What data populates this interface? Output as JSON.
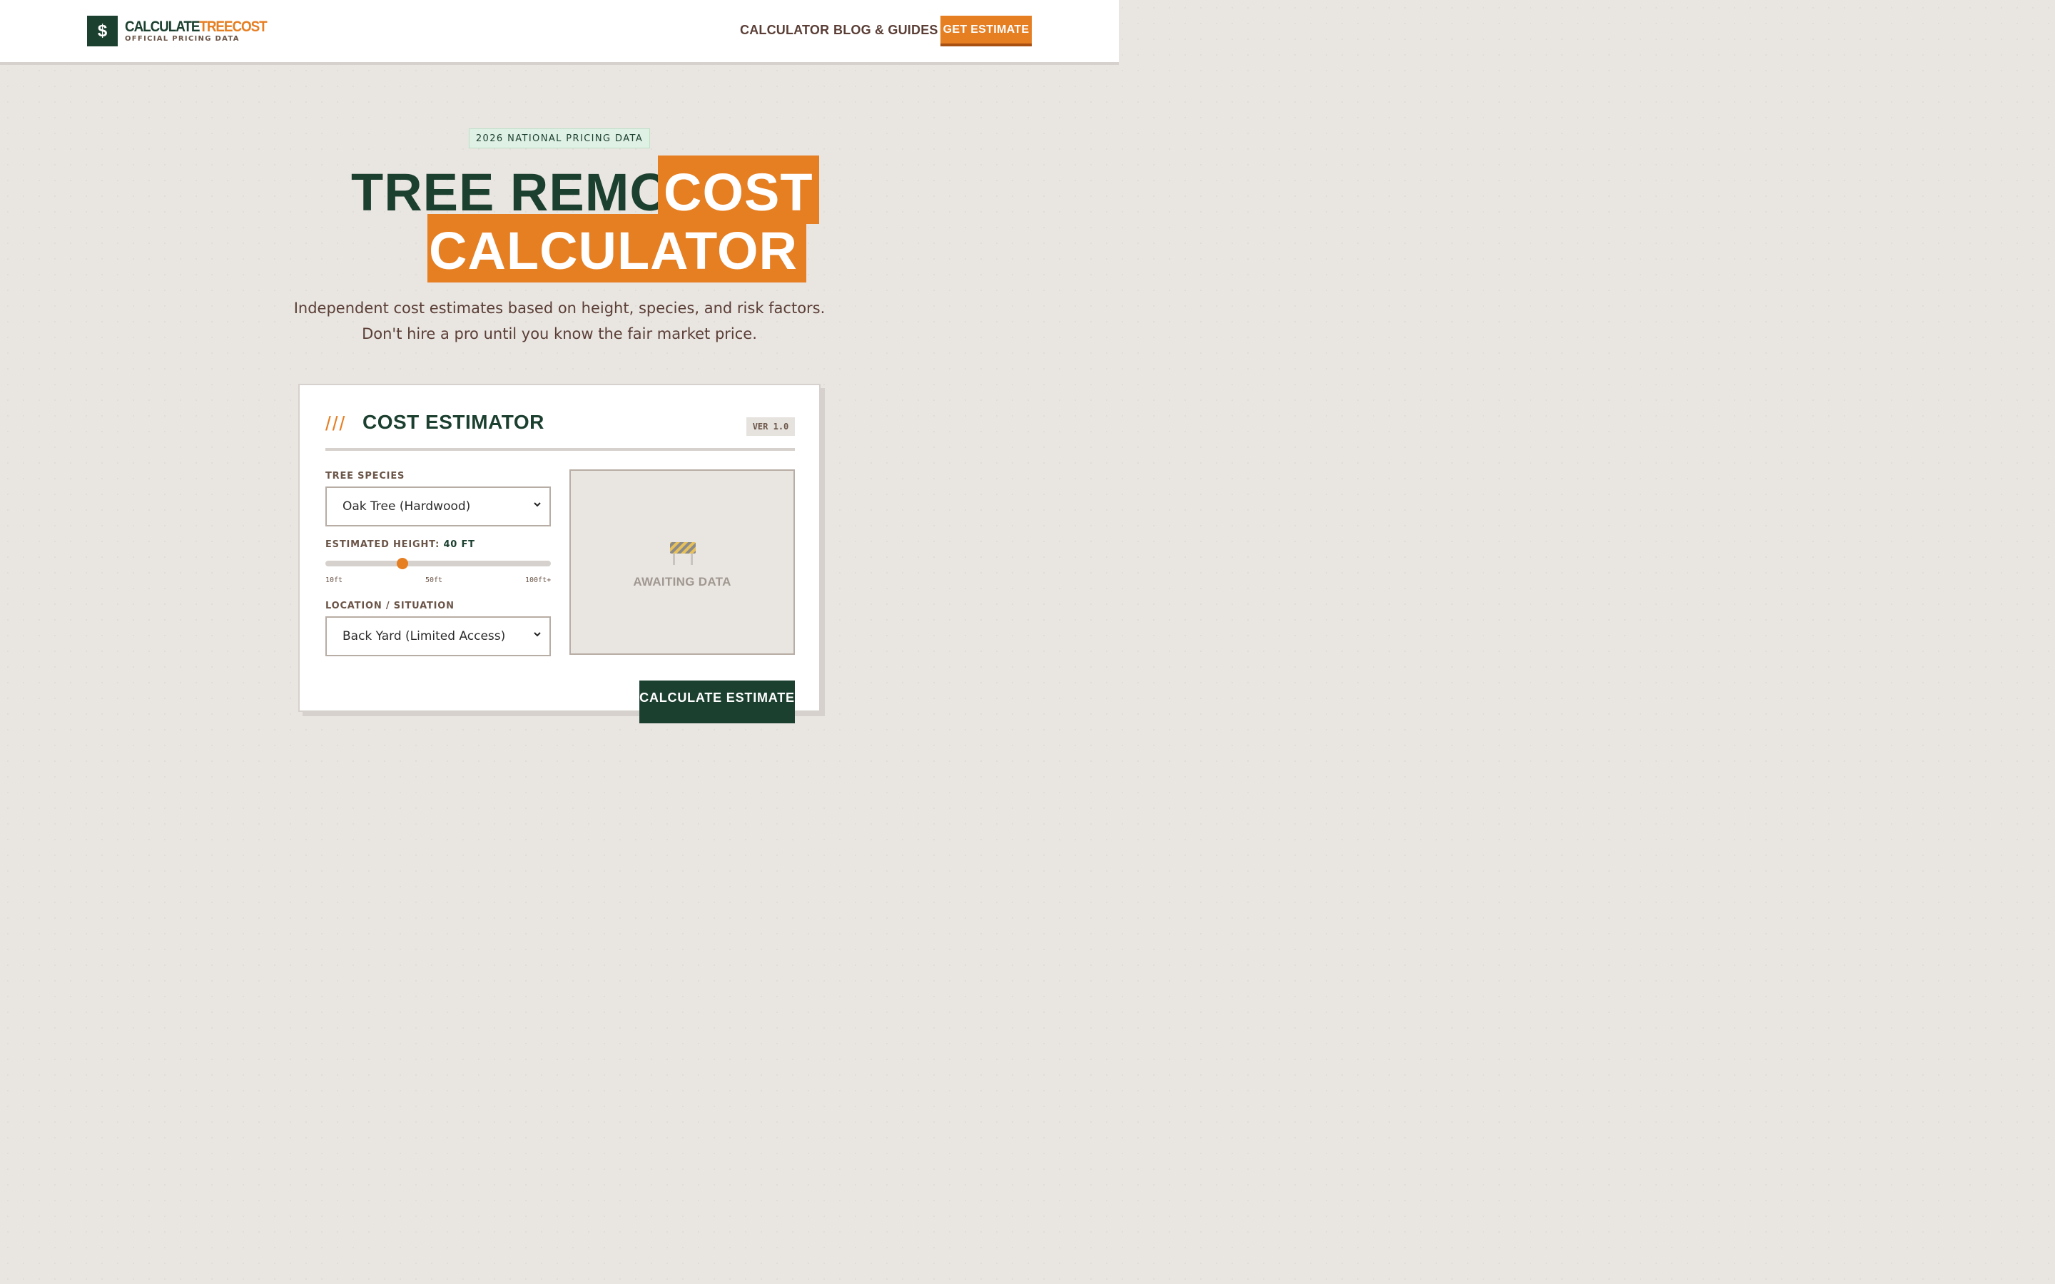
{
  "header": {
    "logo_symbol": "$",
    "logo_word_a": "CALCULATE",
    "logo_word_b": "TREECOST",
    "logo_tagline": "OFFICIAL PRICING DATA",
    "nav": [
      "CALCULATOR",
      "BLOG & GUIDES"
    ],
    "cta_label": "GET ESTIMATE"
  },
  "hero": {
    "badge": "2026 NATIONAL PRICING DATA",
    "title_line1_dark": "TREE REMOVAL",
    "title_line1_highlight": "COST",
    "title_line2_highlight": "CALCULATOR",
    "subtitle_line1": "Independent cost estimates based on height, species, and risk factors.",
    "subtitle_line2": "Don't hire a pro until you know the fair market price."
  },
  "estimator": {
    "slashes": "///",
    "title": "COST ESTIMATOR",
    "version": "VER 1.0",
    "species_label": "TREE SPECIES",
    "species_value": "Oak Tree (Hardwood)",
    "height_label": "ESTIMATED HEIGHT:",
    "height_value": "40 FT",
    "height_fraction": 0.333,
    "height_ticks": [
      "10ft",
      "50ft",
      "100ft+"
    ],
    "location_label": "LOCATION / SITUATION",
    "location_value": "Back Yard (Limited Access)",
    "result_status": "AWAITING DATA",
    "calculate_label": "CALCULATE ESTIMATE"
  },
  "colors": {
    "brand_green": "#1c4030",
    "accent_orange": "#e67e22",
    "background": "#e9e5e1"
  }
}
